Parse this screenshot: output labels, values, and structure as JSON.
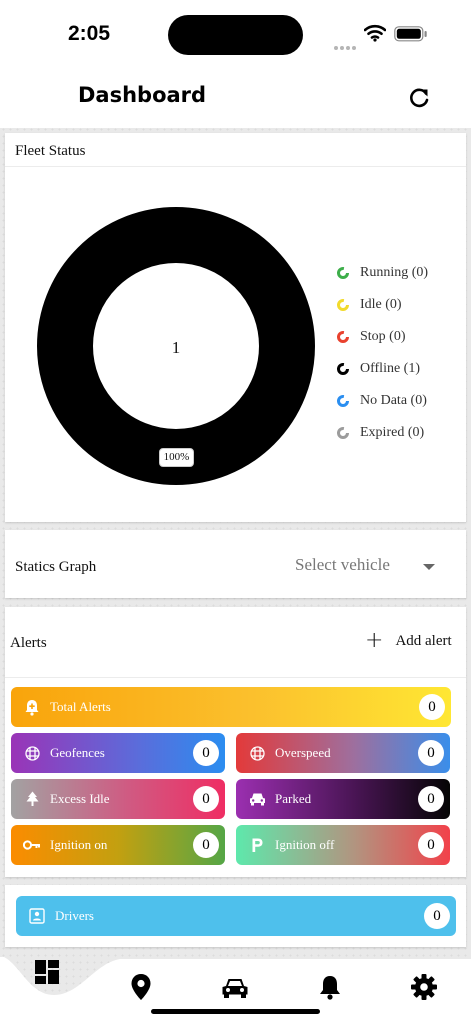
{
  "status_bar": {
    "time": "2:05"
  },
  "header": {
    "title": "Dashboard"
  },
  "fleet_status": {
    "title": "Fleet Status",
    "total": "1",
    "percent": "100%",
    "legend": [
      {
        "label": "Running (0)",
        "color": "#3dae4a"
      },
      {
        "label": "Idle (0)",
        "color": "#f2da2c"
      },
      {
        "label": "Stop (0)",
        "color": "#e9412e"
      },
      {
        "label": "Offline (1)",
        "color": "#000000"
      },
      {
        "label": "No Data (0)",
        "color": "#2a8ef0"
      },
      {
        "label": "Expired (0)",
        "color": "#9c9c9c"
      }
    ]
  },
  "statics": {
    "title": "Statics Graph",
    "select_placeholder": "Select vehicle"
  },
  "alerts": {
    "title": "Alerts",
    "add_label": "Add alert",
    "total": {
      "label": "Total Alerts",
      "count": "0"
    },
    "tiles": [
      {
        "label": "Geofences",
        "count": "0",
        "icon": "grid-icon"
      },
      {
        "label": "Overspeed",
        "count": "0",
        "icon": "grid-icon"
      },
      {
        "label": "Excess Idle",
        "count": "0",
        "icon": "tree-icon"
      },
      {
        "label": "Parked",
        "count": "0",
        "icon": "car-icon"
      },
      {
        "label": "Ignition on",
        "count": "0",
        "icon": "key-icon"
      },
      {
        "label": "Ignition off",
        "count": "0",
        "icon": "parking-icon"
      }
    ]
  },
  "drivers": {
    "label": "Drivers",
    "count": "0"
  },
  "bottom_nav": [
    "dashboard-icon",
    "location-pin-icon",
    "car-icon",
    "bell-icon",
    "gear-icon"
  ]
}
